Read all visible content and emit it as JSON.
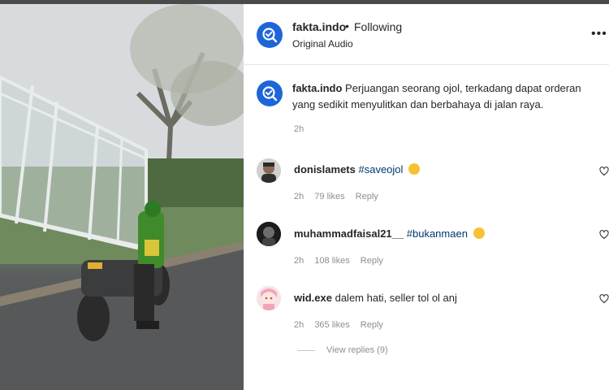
{
  "header": {
    "username": "fakta.indo",
    "separator": "•",
    "follow_status": "Following",
    "audio": "Original Audio",
    "more_label": "•••"
  },
  "caption": {
    "username": "fakta.indo",
    "text": "Perjuangan seorang ojol, terkadang dapat orderan yang sedikit menyulitkan dan berbahaya di jalan raya.",
    "time": "2h"
  },
  "comments": [
    {
      "username": "donislamets",
      "tag": "#saveojol",
      "text": "",
      "time": "2h",
      "likes": "79 likes",
      "reply": "Reply"
    },
    {
      "username": "muhammadfaisal21__",
      "tag": "#bukanmaen",
      "text": "",
      "time": "2h",
      "likes": "108 likes",
      "reply": "Reply"
    },
    {
      "username": "wid.exe",
      "tag": "",
      "text": "dalem hati, seller tol ol anj",
      "time": "2h",
      "likes": "365 likes",
      "reply": "Reply"
    }
  ],
  "view_replies": "View replies (9)",
  "icons": {
    "verified_logo": "check-magnifier-icon",
    "heart": "heart-outline-icon",
    "more": "more-horizontal-icon"
  },
  "colors": {
    "brand_blue": "#1e66d8",
    "tag_blue": "#00376b",
    "muted": "#8e8e8e"
  }
}
